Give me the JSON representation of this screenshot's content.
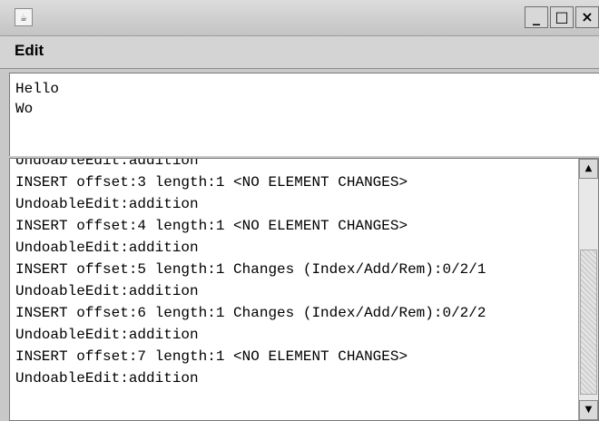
{
  "window": {
    "icon": "java-cup-icon",
    "controls": {
      "minimize": "_",
      "maximize": "□",
      "close": "×"
    }
  },
  "menubar": {
    "items": [
      {
        "label": "Edit"
      }
    ]
  },
  "editor": {
    "lines": [
      "Hello",
      "Wo"
    ]
  },
  "log": {
    "lines": [
      "UndoableEdit:addition",
      "INSERT offset:3 length:1 <NO ELEMENT CHANGES>",
      "UndoableEdit:addition",
      "INSERT offset:4 length:1 <NO ELEMENT CHANGES>",
      "UndoableEdit:addition",
      "INSERT offset:5 length:1 Changes (Index/Add/Rem):0/2/1",
      "UndoableEdit:addition",
      "INSERT offset:6 length:1 Changes (Index/Add/Rem):0/2/2",
      "UndoableEdit:addition",
      "INSERT offset:7 length:1 <NO ELEMENT CHANGES>",
      "UndoableEdit:addition"
    ]
  },
  "scrollbar": {
    "up": "▲",
    "down": "▼"
  }
}
